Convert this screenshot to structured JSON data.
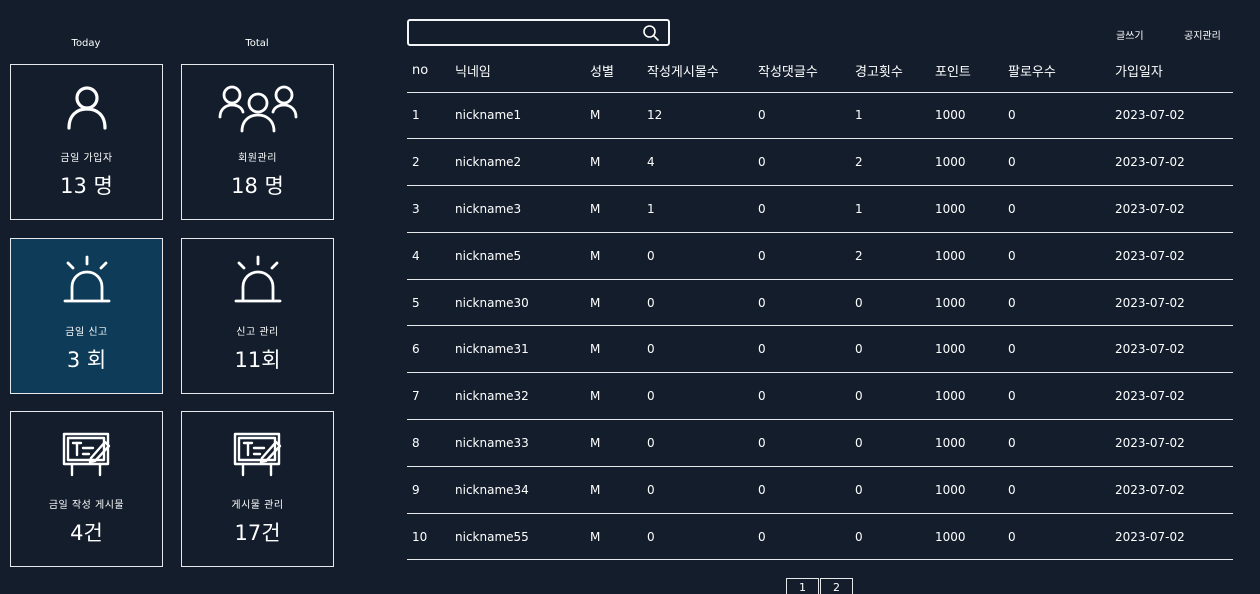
{
  "stats": {
    "today_label": "Today",
    "total_label": "Total",
    "cards": [
      {
        "icon": "user-icon",
        "label": "금일 가입자",
        "value": "13 명"
      },
      {
        "icon": "users-group-icon",
        "label": "회원관리",
        "value": "18 명"
      },
      {
        "icon": "alarm-siren-icon",
        "label": "금일 신고",
        "value": "3 회"
      },
      {
        "icon": "alarm-siren-icon",
        "label": "신고 관리",
        "value": "11회"
      },
      {
        "icon": "board-write-icon",
        "label": "금일 작성 게시물",
        "value": "4건"
      },
      {
        "icon": "board-write-icon",
        "label": "게시물 관리",
        "value": "17건"
      }
    ],
    "active_color": "#0e3c58"
  },
  "search": {
    "placeholder": "",
    "value": ""
  },
  "top_links": {
    "write": "글쓰기",
    "notice_manage": "공지관리"
  },
  "table": {
    "headers": [
      "no",
      "닉네임",
      "성별",
      "작성게시물수",
      "작성댓글수",
      "경고횟수",
      "포인트",
      "팔로우수",
      "가입일자"
    ],
    "rows": [
      [
        "1",
        "nickname1",
        "M",
        "12",
        "0",
        "1",
        "1000",
        "0",
        "2023-07-02"
      ],
      [
        "2",
        "nickname2",
        "M",
        "4",
        "0",
        "2",
        "1000",
        "0",
        "2023-07-02"
      ],
      [
        "3",
        "nickname3",
        "M",
        "1",
        "0",
        "1",
        "1000",
        "0",
        "2023-07-02"
      ],
      [
        "4",
        "nickname5",
        "M",
        "0",
        "0",
        "2",
        "1000",
        "0",
        "2023-07-02"
      ],
      [
        "5",
        "nickname30",
        "M",
        "0",
        "0",
        "0",
        "1000",
        "0",
        "2023-07-02"
      ],
      [
        "6",
        "nickname31",
        "M",
        "0",
        "0",
        "0",
        "1000",
        "0",
        "2023-07-02"
      ],
      [
        "7",
        "nickname32",
        "M",
        "0",
        "0",
        "0",
        "1000",
        "0",
        "2023-07-02"
      ],
      [
        "8",
        "nickname33",
        "M",
        "0",
        "0",
        "0",
        "1000",
        "0",
        "2023-07-02"
      ],
      [
        "9",
        "nickname34",
        "M",
        "0",
        "0",
        "0",
        "1000",
        "0",
        "2023-07-02"
      ],
      [
        "10",
        "nickname55",
        "M",
        "0",
        "0",
        "0",
        "1000",
        "0",
        "2023-07-02"
      ]
    ]
  },
  "pagination": {
    "pages": [
      "1",
      "2"
    ]
  }
}
